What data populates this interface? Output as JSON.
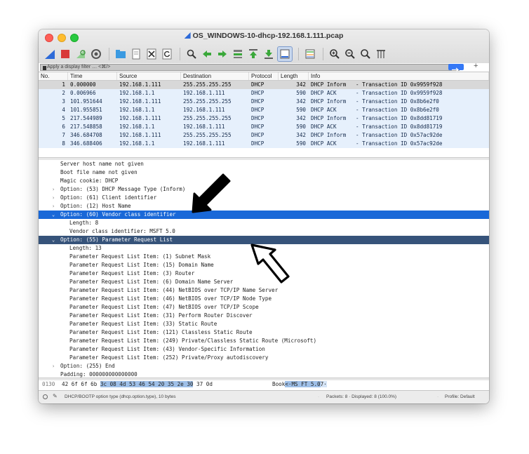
{
  "window": {
    "title": "OS_WINDOWS-10-dhcp-192.168.1.111.pcap",
    "accent": "#2d6ad8"
  },
  "toolbar": {
    "icons": [
      "shark-fin-start-icon",
      "stop-capture-icon",
      "restart-capture-icon",
      "capture-options-icon",
      "open-file-icon",
      "save-file-icon",
      "close-file-icon",
      "reload-icon",
      "find-icon",
      "go-back-icon",
      "go-forward-icon",
      "go-to-packet-icon",
      "first-packet-icon",
      "last-packet-icon",
      "auto-scroll-icon",
      "colorize-icon",
      "zoom-in-icon",
      "zoom-out-icon",
      "normal-size-icon",
      "resize-columns-icon"
    ]
  },
  "filter": {
    "placeholder": "Apply a display filter … <⌘/>",
    "add_label": "+"
  },
  "packet_list": {
    "columns": [
      "No.",
      "Time",
      "Source",
      "Destination",
      "Protocol",
      "Length",
      "Info"
    ],
    "rows": [
      {
        "no": "1",
        "time": "0.000000",
        "src": "192.168.1.111",
        "dst": "255.255.255.255",
        "proto": "DHCP",
        "len": "342",
        "info": "DHCP Inform   - Transaction ID 0x9959f928"
      },
      {
        "no": "2",
        "time": "0.006966",
        "src": "192.168.1.1",
        "dst": "192.168.1.111",
        "proto": "DHCP",
        "len": "590",
        "info": "DHCP ACK      - Transaction ID 0x9959f928"
      },
      {
        "no": "3",
        "time": "101.951644",
        "src": "192.168.1.111",
        "dst": "255.255.255.255",
        "proto": "DHCP",
        "len": "342",
        "info": "DHCP Inform   - Transaction ID 0x8b6e2f0"
      },
      {
        "no": "4",
        "time": "101.955851",
        "src": "192.168.1.1",
        "dst": "192.168.1.111",
        "proto": "DHCP",
        "len": "590",
        "info": "DHCP ACK      - Transaction ID 0x8b6e2f0"
      },
      {
        "no": "5",
        "time": "217.544989",
        "src": "192.168.1.111",
        "dst": "255.255.255.255",
        "proto": "DHCP",
        "len": "342",
        "info": "DHCP Inform   - Transaction ID 0x8dd81719"
      },
      {
        "no": "6",
        "time": "217.548858",
        "src": "192.168.1.1",
        "dst": "192.168.1.111",
        "proto": "DHCP",
        "len": "590",
        "info": "DHCP ACK      - Transaction ID 0x8dd81719"
      },
      {
        "no": "7",
        "time": "346.684708",
        "src": "192.168.1.111",
        "dst": "255.255.255.255",
        "proto": "DHCP",
        "len": "342",
        "info": "DHCP Inform   - Transaction ID 0x57ac92de"
      },
      {
        "no": "8",
        "time": "346.688406",
        "src": "192.168.1.1",
        "dst": "192.168.1.111",
        "proto": "DHCP",
        "len": "590",
        "info": "DHCP ACK      - Transaction ID 0x57ac92de"
      }
    ]
  },
  "details": [
    {
      "text": "Server host name not given",
      "indent": 1,
      "state": "none"
    },
    {
      "text": "Boot file name not given",
      "indent": 1,
      "state": "none"
    },
    {
      "text": "Magic cookie: DHCP",
      "indent": 1,
      "state": "none"
    },
    {
      "text": "Option: (53) DHCP Message Type (Inform)",
      "indent": 1,
      "state": "collapsed"
    },
    {
      "text": "Option: (61) Client identifier",
      "indent": 1,
      "state": "collapsed"
    },
    {
      "text": "Option: (12) Host Name",
      "indent": 1,
      "state": "collapsed"
    },
    {
      "text": "Option: (60) Vendor class identifier",
      "indent": 1,
      "state": "expanded",
      "highlight": "blue"
    },
    {
      "text": "Length: 8",
      "indent": 2,
      "state": "none"
    },
    {
      "text": "Vendor class identifier: MSFT 5.0",
      "indent": 2,
      "state": "none"
    },
    {
      "text": "Option: (55) Parameter Request List",
      "indent": 1,
      "state": "expanded",
      "highlight": "gray"
    },
    {
      "text": "Length: 13",
      "indent": 2,
      "state": "none"
    },
    {
      "text": "Parameter Request List Item: (1) Subnet Mask",
      "indent": 2,
      "state": "none"
    },
    {
      "text": "Parameter Request List Item: (15) Domain Name",
      "indent": 2,
      "state": "none"
    },
    {
      "text": "Parameter Request List Item: (3) Router",
      "indent": 2,
      "state": "none"
    },
    {
      "text": "Parameter Request List Item: (6) Domain Name Server",
      "indent": 2,
      "state": "none"
    },
    {
      "text": "Parameter Request List Item: (44) NetBIOS over TCP/IP Name Server",
      "indent": 2,
      "state": "none"
    },
    {
      "text": "Parameter Request List Item: (46) NetBIOS over TCP/IP Node Type",
      "indent": 2,
      "state": "none"
    },
    {
      "text": "Parameter Request List Item: (47) NetBIOS over TCP/IP Scope",
      "indent": 2,
      "state": "none"
    },
    {
      "text": "Parameter Request List Item: (31) Perform Router Discover",
      "indent": 2,
      "state": "none"
    },
    {
      "text": "Parameter Request List Item: (33) Static Route",
      "indent": 2,
      "state": "none"
    },
    {
      "text": "Parameter Request List Item: (121) Classless Static Route",
      "indent": 2,
      "state": "none"
    },
    {
      "text": "Parameter Request List Item: (249) Private/Classless Static Route (Microsoft)",
      "indent": 2,
      "state": "none"
    },
    {
      "text": "Parameter Request List Item: (43) Vendor-Specific Information",
      "indent": 2,
      "state": "none"
    },
    {
      "text": "Parameter Request List Item: (252) Private/Proxy autodiscovery",
      "indent": 2,
      "state": "none"
    },
    {
      "text": "Option: (255) End",
      "indent": 1,
      "state": "collapsed"
    },
    {
      "text": "Padding: 000000000000000",
      "indent": 1,
      "state": "none"
    }
  ],
  "hex": {
    "offset": "0130",
    "pre": "42 6f 6f 6b ",
    "sel": "3c 08 4d 53  46 54 20 35 2e 30",
    "post": " 37 0d",
    "ascii_pre": "Book",
    "ascii_sel": "<·MS FT 5.0",
    "ascii_post": "7·"
  },
  "status": {
    "field_text": "DHCP/BOOTP option type (dhcp.option.type), 10 bytes",
    "packets_text": "Packets: 8 · Displayed: 8 (100.0%)",
    "profile_text": "Profile: Default"
  }
}
